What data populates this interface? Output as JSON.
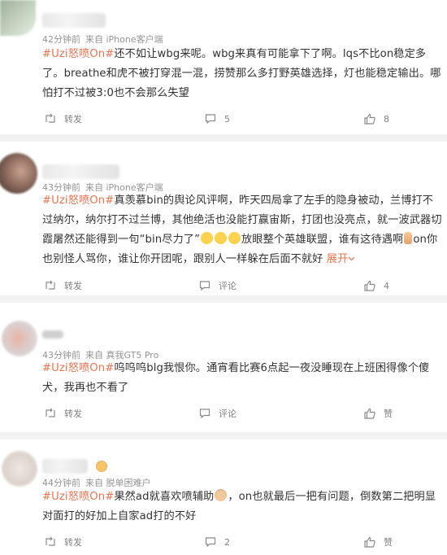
{
  "comments": [
    {
      "meta": {
        "time": "42分钟前",
        "source": "来自 iPhone客户端"
      },
      "tag": "#Uzi怒喷On#",
      "text": "还不如让wbg来呢。wbg来真有可能拿下了啊。lqs不比on稳定多了。breathe和虎不被打穿混一混，捞赞那么多打野英雄选择，灯也能稳定输出。哪怕打不过被3:0也不会那么失望",
      "actions": {
        "repost": "转发",
        "comments": "5",
        "likes": "8"
      }
    },
    {
      "meta": {
        "time": "43分钟前",
        "source": "来自 iPhone客户端"
      },
      "tag": "#Uzi怒喷On#",
      "text_a": "真羡慕bin的舆论风评啊，昨天四局拿了左手的隐身被动，兰博打不过纳尔，纳尔打不过兰博，其他绝活也没能打赢宙斯，打团也没亮点，就一波武器切霞屠然还能得到一句“bin尽力了”",
      "text_b": "放眼整个英雄联盟，谁有这待遇啊",
      "text_c": "on你也别怪人骂你，谁让你开团呢，跟别人一样躲在后面不就好",
      "expand": "展开",
      "actions": {
        "repost": "转发",
        "comments": "评论",
        "likes": "4"
      }
    },
    {
      "meta": {
        "time": "43分钟前",
        "source": "来自 真我GT5 Pro"
      },
      "tag": "#Uzi怒喷On#",
      "text": "呜呜呜blg我恨你。通宵看比赛6点起一夜没睡现在上班困得像个傻犬，我再也不看了",
      "actions": {
        "repost": "转发",
        "comments": "评论",
        "likes": "赞"
      }
    },
    {
      "meta": {
        "time": "44分钟前",
        "source": "来自 脱单困难户"
      },
      "tag": "#Uzi怒喷On#",
      "text_a": "果然ad就喜欢喷辅助",
      "text_b": "，on也就最后一把有问题，倒数第二把明显对面打的好加上自家ad打的不好",
      "actions": {
        "repost": "转发",
        "comments": "2",
        "likes": "赞"
      }
    }
  ],
  "colors": {
    "tag": "#eb7350",
    "meta": "#939393",
    "text": "#333333",
    "action": "#808080"
  }
}
